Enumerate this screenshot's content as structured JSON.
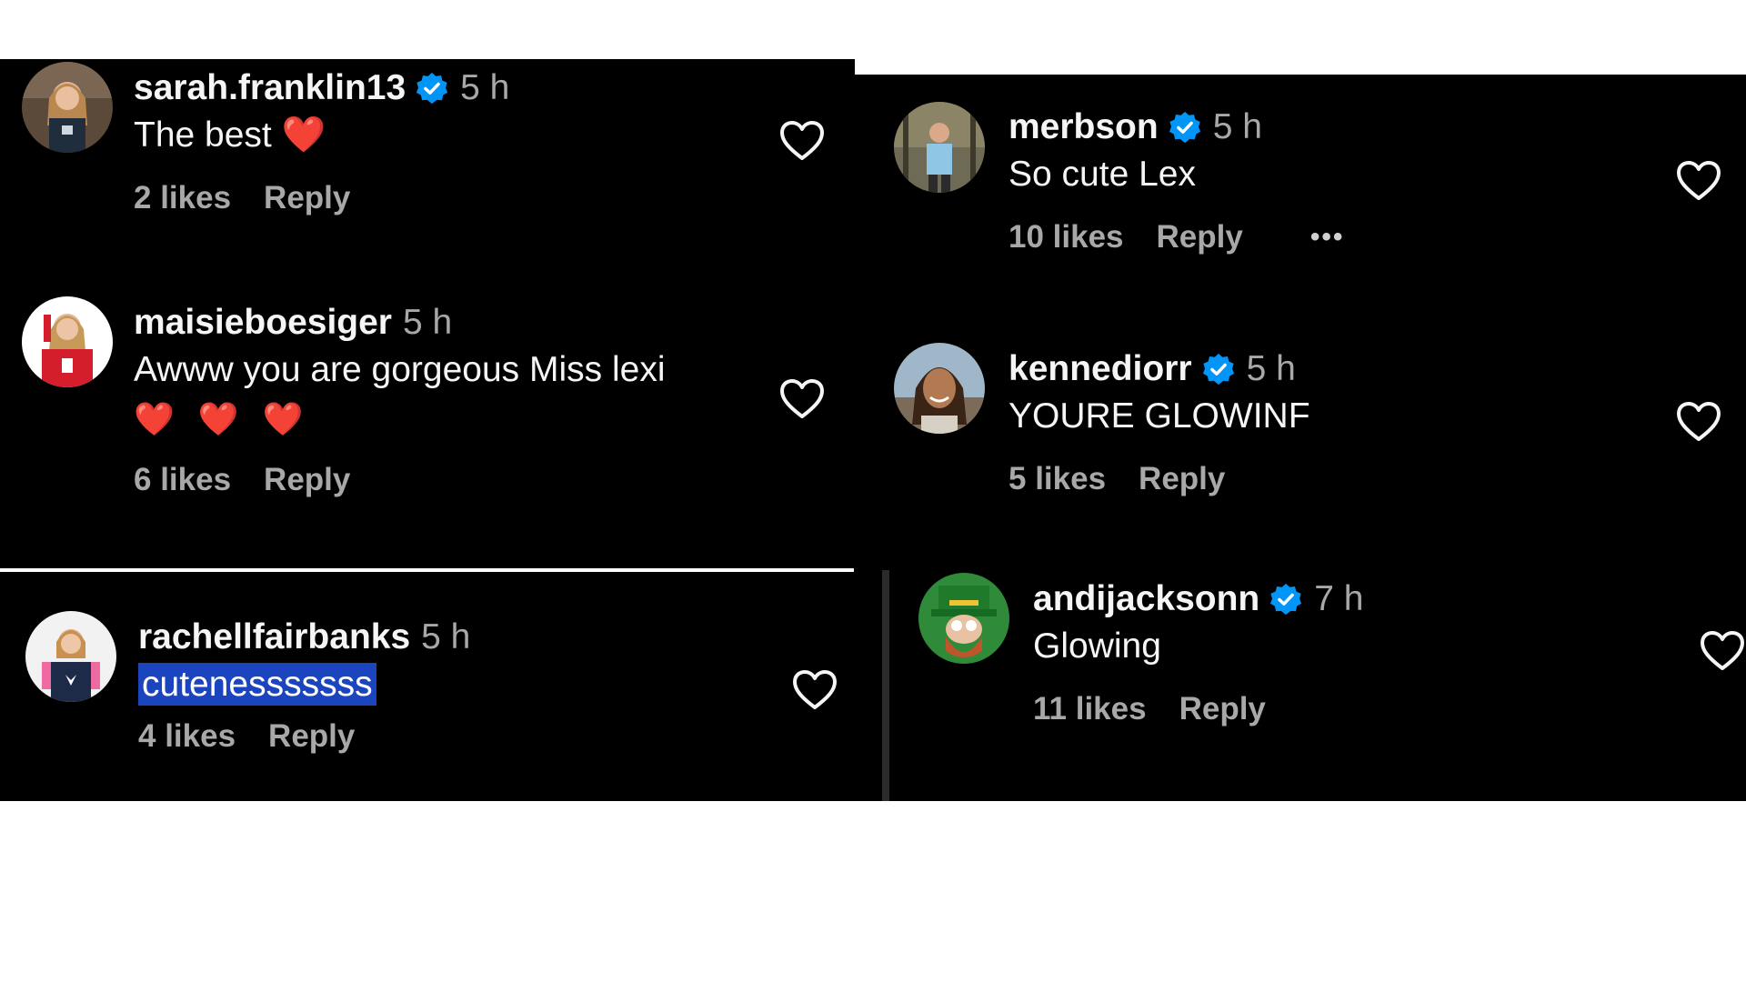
{
  "comments": [
    {
      "username": "sarah.franklin13",
      "verified": true,
      "time": "5 h",
      "text": "The best",
      "emoji": "❤️",
      "likes": "2 likes",
      "reply": "Reply"
    },
    {
      "username": "maisieboesiger",
      "verified": false,
      "time": "5 h",
      "text": "Awww you are gorgeous Miss lexi",
      "emoji": "❤️ ❤️ ❤️",
      "likes": "6 likes",
      "reply": "Reply"
    },
    {
      "username": "rachellfairbanks",
      "verified": false,
      "time": "5 h",
      "text": "cutenesssssss",
      "likes": "4 likes",
      "reply": "Reply"
    },
    {
      "username": "merbson",
      "verified": true,
      "time": "5 h",
      "text": "So cute Lex",
      "likes": "10 likes",
      "reply": "Reply",
      "more": "•••"
    },
    {
      "username": "kennediorr",
      "verified": true,
      "time": "5 h",
      "text": "YOURE GLOWINF",
      "likes": "5 likes",
      "reply": "Reply"
    },
    {
      "username": "andijacksonn",
      "verified": true,
      "time": "7 h",
      "text": "Glowing",
      "likes": "11 likes",
      "reply": "Reply"
    }
  ],
  "colors": {
    "background": "#000000",
    "text": "#f5f5f5",
    "muted": "#a8a8a8",
    "verified": "#0095f6",
    "selection": "#1b45bf",
    "emoji_heart": "#ff2c3e"
  },
  "icons": {
    "verified": "verified-badge-icon",
    "like": "heart-outline-icon",
    "more": "more-options-icon"
  }
}
